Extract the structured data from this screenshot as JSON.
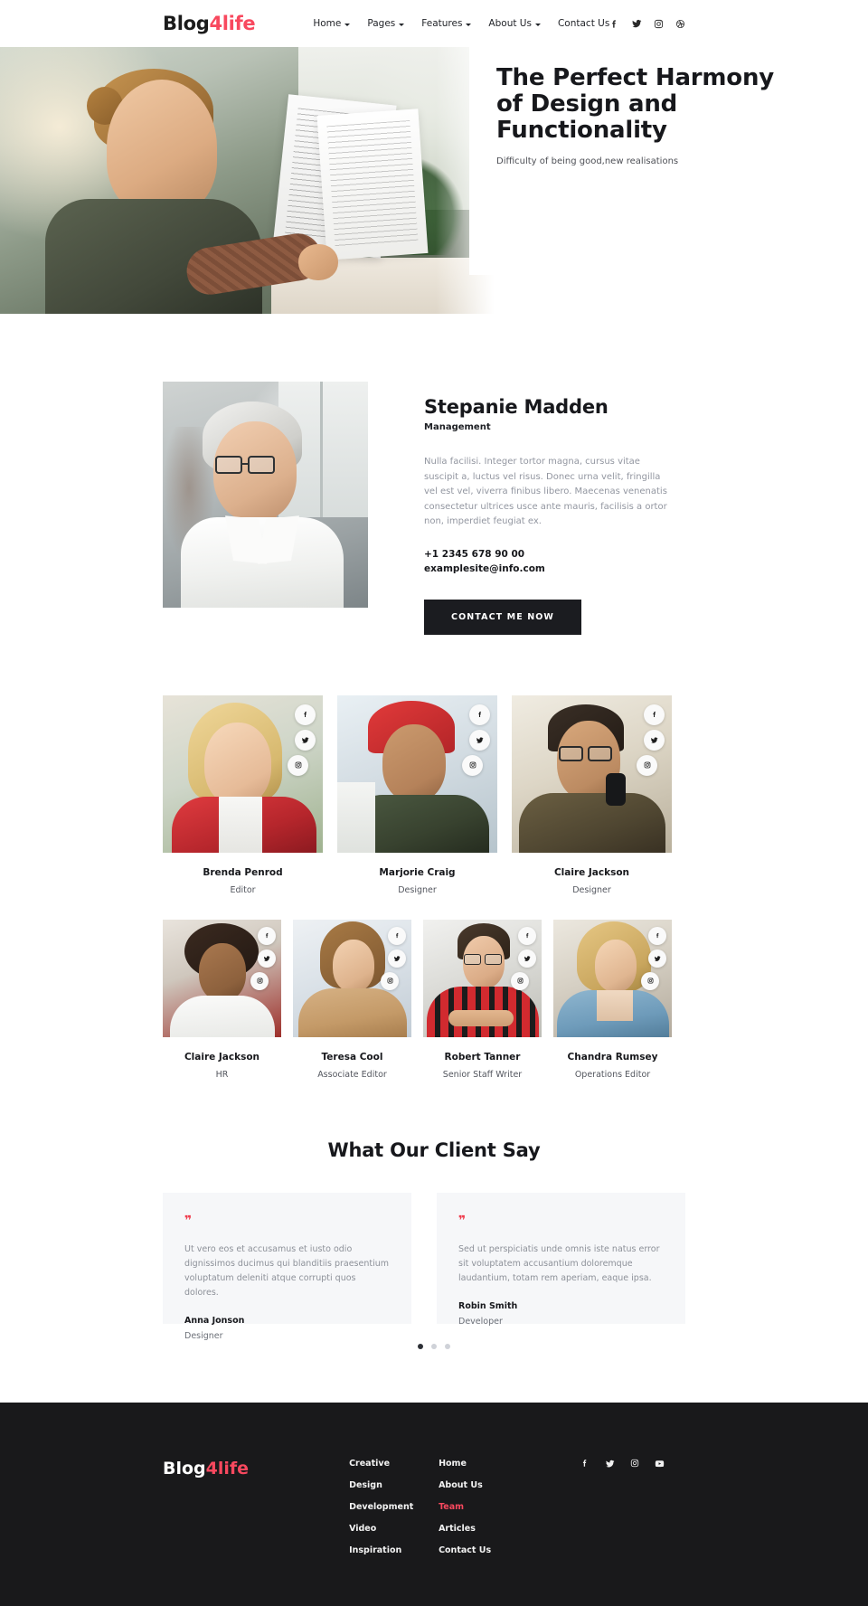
{
  "header": {
    "brand_dark": "Blog",
    "brand_red": "4life",
    "nav": [
      {
        "label": "Home",
        "has_caret": true
      },
      {
        "label": "Pages",
        "has_caret": true
      },
      {
        "label": "Features",
        "has_caret": true
      },
      {
        "label": "About Us",
        "has_caret": true
      },
      {
        "label": "Contact Us",
        "has_caret": false
      }
    ],
    "social": [
      "facebook-icon",
      "twitter-icon",
      "instagram-icon",
      "dribbble-icon"
    ]
  },
  "hero": {
    "title": "The Perfect Harmony of Design and Functionality",
    "subtitle": "Difficulty of being good,new realisations"
  },
  "profile": {
    "name": "Stepanie Madden",
    "role": "Management",
    "description": "Nulla facilisi. Integer tortor magna, cursus vitae suscipit a, luctus vel risus. Donec urna velit, fringilla vel est vel, viverra finibus libero. Maecenas venenatis consectetur ultrices usce ante mauris, facilisis a ortor non, imperdiet feugiat ex.",
    "phone": "+1 2345 678 90 00",
    "email": "examplesite@info.com",
    "cta_label": "CONTACT ME NOW"
  },
  "team": {
    "row1": [
      {
        "name": "Brenda Penrod",
        "role": "Editor"
      },
      {
        "name": "Marjorie Craig",
        "role": "Designer"
      },
      {
        "name": "Claire Jackson",
        "role": "Designer"
      }
    ],
    "row2": [
      {
        "name": "Claire Jackson",
        "role": "HR"
      },
      {
        "name": "Teresa Cool",
        "role": "Associate Editor"
      },
      {
        "name": "Robert Tanner",
        "role": "Senior Staff Writer"
      },
      {
        "name": "Chandra Rumsey",
        "role": "Operations Editor"
      }
    ],
    "card_social": [
      "facebook-icon",
      "twitter-icon",
      "instagram-icon"
    ]
  },
  "testimonials": {
    "title": "What Our Client Say",
    "items": [
      {
        "quote": "Ut vero eos et accusamus et iusto odio dignissimos ducimus qui blanditiis praesentium voluptatum deleniti atque corrupti quos dolores.",
        "author": "Anna Jonson",
        "role": "Designer"
      },
      {
        "quote": "Sed ut perspiciatis unde omnis iste natus error sit voluptatem accusantium doloremque laudantium, totam rem aperiam, eaque ipsa.",
        "author": "Robin Smith",
        "role": "Developer"
      }
    ],
    "dots": 3,
    "active_dot": 0
  },
  "footer": {
    "brand_dark": "Blog",
    "brand_red": "4life",
    "col1": [
      "Creative",
      "Design",
      "Development",
      "Video",
      "Inspiration"
    ],
    "col2": [
      "Home",
      "About Us",
      "Team",
      "Articles",
      "Contact Us"
    ],
    "col2_active": "Team",
    "social": [
      "facebook-icon",
      "twitter-icon",
      "instagram-icon",
      "youtube-icon"
    ]
  },
  "colors": {
    "accent_red": "#f8485e",
    "quote_red": "#ef3d4e",
    "dark": "#19191b",
    "muted": "#9296a0",
    "card_bg": "#f6f7f9"
  }
}
